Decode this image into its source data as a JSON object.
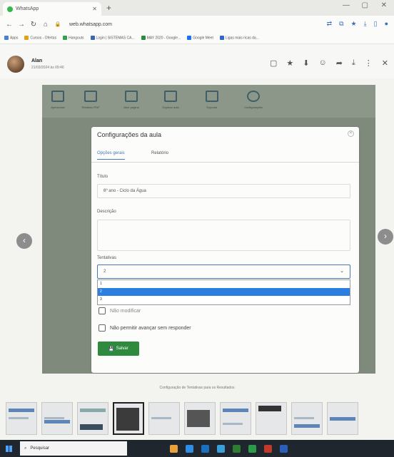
{
  "browser": {
    "tab_title": "WhatsApp",
    "url": "web.whatsapp.com",
    "bookmarks": [
      "Apps",
      "Cursos - Ofertas",
      "Hangouts",
      "Login | SISTEMAS CA...",
      "MAY 2020 - Google...",
      "Google Meet",
      "Ligas mais ricas da..."
    ]
  },
  "media_header": {
    "sender": "Alan",
    "sent_time": "21/03/2024 às 09:46"
  },
  "app_toolbar": {
    "items": [
      "Apresentar",
      "Relatório PDF",
      "Abrir página",
      "Duplicar aula",
      "Exportar",
      "Configurações"
    ]
  },
  "dialog": {
    "title": "Configurações da aula",
    "tabs": [
      "Opções gerais",
      "Relatório"
    ],
    "title_field_label": "Título",
    "title_field_value": "6º ano - Ciclo da Água",
    "description_label": "Descrição",
    "attempts_label": "Tentativas",
    "attempts_selected": "2",
    "attempts_options": [
      "1",
      "2",
      "3"
    ],
    "checkbox_hidden": "Não modificar",
    "checkbox_no_skip": "Não permitir avançar sem responder",
    "save_label": "Salvar"
  },
  "caption": "Configuração de Tentativas para os Resultados",
  "taskbar": {
    "search_placeholder": "Pesquisar"
  },
  "colors": {
    "accent_blue": "#4477bb",
    "selected_option": "#2c7ee0",
    "save_green": "#2e8b3e",
    "whatsapp_green": "#35b94a"
  }
}
